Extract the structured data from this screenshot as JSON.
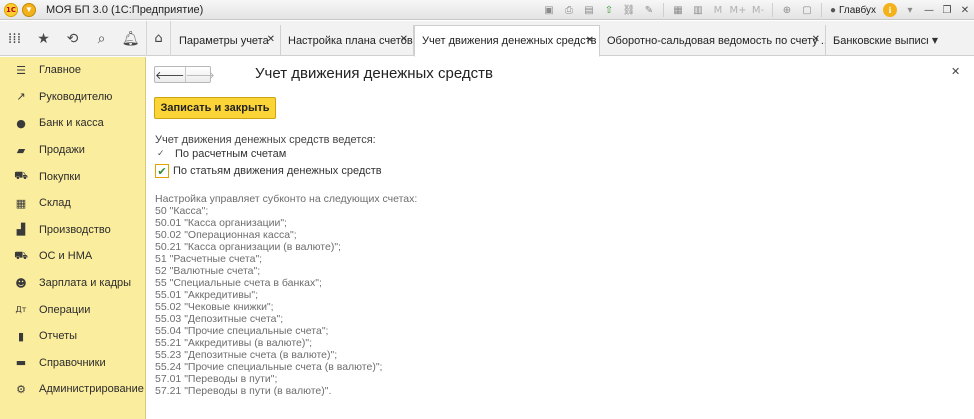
{
  "titlebar": {
    "app_title": "МОЯ БП 3.0  (1С:Предприятие)",
    "user": "Главбух",
    "logo_text": "1С"
  },
  "nav": {
    "icons": [
      "apps-grid-icon",
      "favorites-star-icon",
      "history-icon",
      "search-icon",
      "notifications-bell-icon"
    ]
  },
  "tabs": [
    {
      "label": "Параметры учета",
      "active": false
    },
    {
      "label": "Настройка плана счетов",
      "active": false
    },
    {
      "label": "Учет движения денежных средств",
      "active": true
    },
    {
      "label": "Оборотно-сальдовая ведомость по счету ...",
      "active": false
    },
    {
      "label": "Банковские выписки",
      "active": false
    }
  ],
  "sidebar": {
    "items": [
      {
        "label": "Главное",
        "icon": "menu-lines-icon"
      },
      {
        "label": "Руководителю",
        "icon": "trend-chart-icon"
      },
      {
        "label": "Банк и касса",
        "icon": "ruble-coin-icon"
      },
      {
        "label": "Продажи",
        "icon": "briefcase-icon"
      },
      {
        "label": "Покупки",
        "icon": "cart-icon"
      },
      {
        "label": "Склад",
        "icon": "warehouse-grid-icon"
      },
      {
        "label": "Производство",
        "icon": "factory-icon"
      },
      {
        "label": "ОС и НМА",
        "icon": "truck-icon"
      },
      {
        "label": "Зарплата и кадры",
        "icon": "people-icon"
      },
      {
        "label": "Операции",
        "icon": "debit-credit-icon"
      },
      {
        "label": "Отчеты",
        "icon": "bar-chart-icon"
      },
      {
        "label": "Справочники",
        "icon": "book-icon"
      },
      {
        "label": "Администрирование",
        "icon": "gear-icon"
      }
    ]
  },
  "form": {
    "title": "Учет движения денежных средств",
    "save_label": "Записать и закрыть",
    "maintained_label": "Учет движения денежных средств ведется:",
    "option1": "По расчетным счетам",
    "option2": "По статьям движения денежных средств",
    "option2_checked": true,
    "info_lines": [
      "Настройка управляет субконто на следующих счетах:",
      "50 \"Касса\";",
      "50.01 \"Касса организации\";",
      "50.02 \"Операционная касса\";",
      "50.21 \"Касса организации (в валюте)\";",
      "51 \"Расчетные счета\";",
      "52 \"Валютные счета\";",
      "55 \"Специальные счета в банках\";",
      "55.01 \"Аккредитивы\";",
      "55.02 \"Чековые книжки\";",
      "55.03 \"Депозитные счета\";",
      "55.04 \"Прочие специальные счета\";",
      "55.21 \"Аккредитивы (в валюте)\";",
      "55.23 \"Депозитные счета (в валюте)\";",
      "55.24 \"Прочие специальные счета (в валюте)\";",
      "57.01 \"Переводы в пути\";",
      "57.21 \"Переводы в пути (в валюте)\"."
    ]
  },
  "colors": {
    "sidebar_bg": "#fbed9e",
    "save_button": "#fbd437",
    "checkbox_border": "#e2a200"
  }
}
